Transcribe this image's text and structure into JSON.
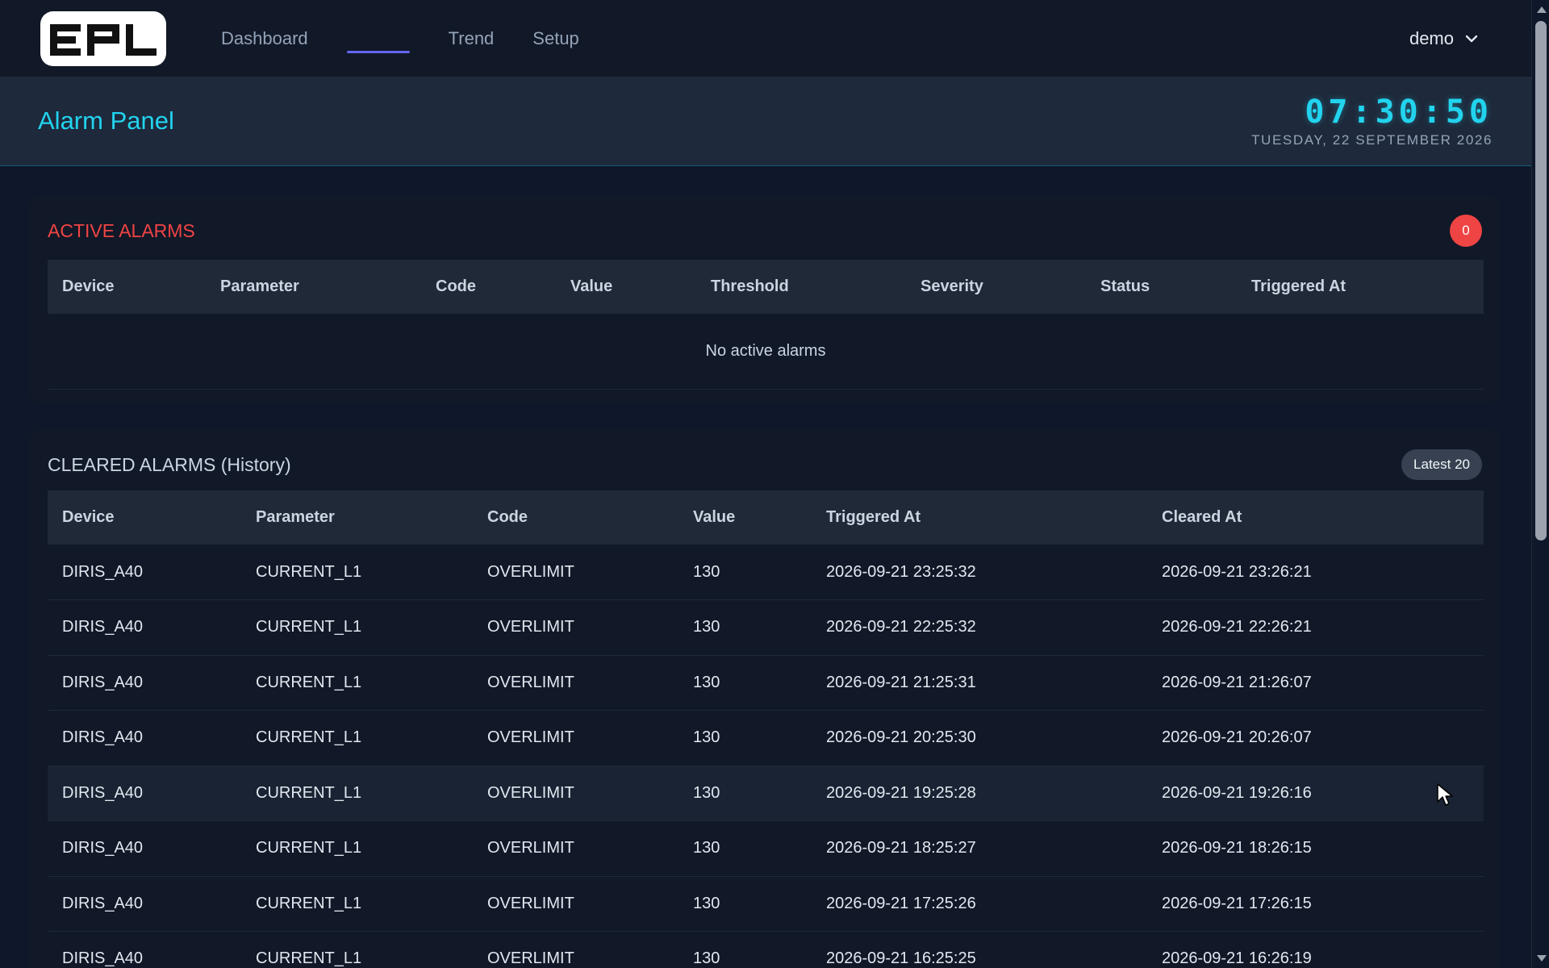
{
  "nav": {
    "logo_text": "EPL",
    "items": [
      {
        "label": "Dashboard",
        "active": false
      },
      {
        "label": "",
        "active": true
      },
      {
        "label": "Trend",
        "active": false
      },
      {
        "label": "Setup",
        "active": false
      }
    ],
    "user": "demo",
    "user_icon": "chevron-down-icon"
  },
  "header": {
    "title": "Alarm Panel",
    "clock": "07:30:50",
    "date": "TUESDAY, 22 SEPTEMBER 2026"
  },
  "active_alarms": {
    "title": "ACTIVE ALARMS",
    "count": "0",
    "columns": [
      "Device",
      "Parameter",
      "Code",
      "Value",
      "Threshold",
      "Severity",
      "Status",
      "Triggered At"
    ],
    "empty_message": "No active alarms"
  },
  "cleared_alarms": {
    "title": "CLEARED ALARMS (History)",
    "badge": "Latest 20",
    "columns": [
      "Device",
      "Parameter",
      "Code",
      "Value",
      "Triggered At",
      "Cleared At"
    ],
    "rows": [
      [
        "DIRIS_A40",
        "CURRENT_L1",
        "OVERLIMIT",
        "130",
        "2026-09-21 23:25:32",
        "2026-09-21 23:26:21"
      ],
      [
        "DIRIS_A40",
        "CURRENT_L1",
        "OVERLIMIT",
        "130",
        "2026-09-21 22:25:32",
        "2026-09-21 22:26:21"
      ],
      [
        "DIRIS_A40",
        "CURRENT_L1",
        "OVERLIMIT",
        "130",
        "2026-09-21 21:25:31",
        "2026-09-21 21:26:07"
      ],
      [
        "DIRIS_A40",
        "CURRENT_L1",
        "OVERLIMIT",
        "130",
        "2026-09-21 20:25:30",
        "2026-09-21 20:26:07"
      ],
      [
        "DIRIS_A40",
        "CURRENT_L1",
        "OVERLIMIT",
        "130",
        "2026-09-21 19:25:28",
        "2026-09-21 19:26:16"
      ],
      [
        "DIRIS_A40",
        "CURRENT_L1",
        "OVERLIMIT",
        "130",
        "2026-09-21 18:25:27",
        "2026-09-21 18:26:15"
      ],
      [
        "DIRIS_A40",
        "CURRENT_L1",
        "OVERLIMIT",
        "130",
        "2026-09-21 17:25:26",
        "2026-09-21 17:26:15"
      ],
      [
        "DIRIS_A40",
        "CURRENT_L1",
        "OVERLIMIT",
        "130",
        "2026-09-21 16:25:25",
        "2026-09-21 16:26:19"
      ]
    ]
  },
  "colors": {
    "background": "#0f172a",
    "accent": "#22d3ee",
    "alarm": "#ef4444",
    "nav_active": "#6366f1"
  }
}
